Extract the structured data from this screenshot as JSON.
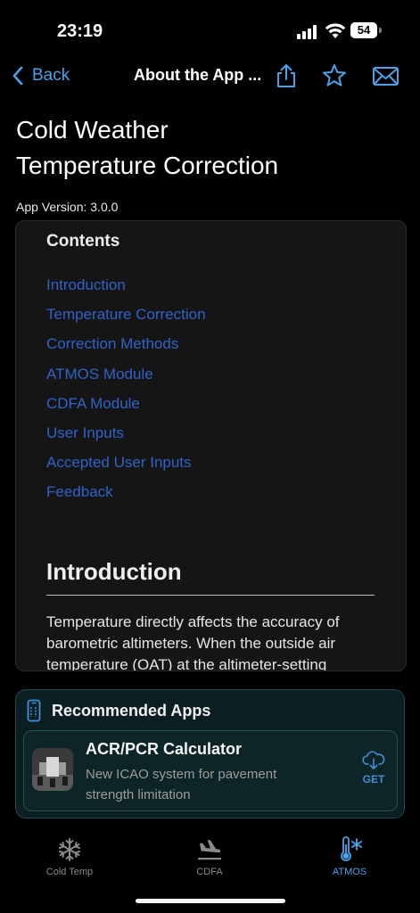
{
  "status_bar": {
    "time": "23:19",
    "battery": "54"
  },
  "nav": {
    "back_label": "Back",
    "title": "About the App ..."
  },
  "page": {
    "title_line1": "Cold Weather",
    "title_line2": "Temperature Correction",
    "version": "App Version: 3.0.0"
  },
  "contents": {
    "heading": "Contents",
    "items": [
      "Introduction",
      "Temperature Correction",
      "Correction Methods",
      "ATMOS Module",
      "CDFA Module",
      "User Inputs",
      "Accepted User Inputs",
      "Feedback"
    ]
  },
  "introduction": {
    "heading": "Introduction",
    "text": "Temperature directly affects the accuracy of barometric altimeters. When the outside air temperature (OAT) at the altimeter-setting"
  },
  "recommended": {
    "title": "Recommended Apps",
    "app_name": "ACR/PCR Calculator",
    "app_desc": "New ICAO system for pavement strength limitation",
    "get_label": "GET"
  },
  "tabs": [
    {
      "label": "Cold Temp",
      "icon": "snowflake-icon"
    },
    {
      "label": "CDFA",
      "icon": "airplane-landing-icon"
    },
    {
      "label": "ATMOS",
      "icon": "thermometer-snowflake-icon"
    }
  ],
  "colors": {
    "accent": "#4aa2e8",
    "link": "#2f63c9",
    "panel": "#0b1e22"
  }
}
